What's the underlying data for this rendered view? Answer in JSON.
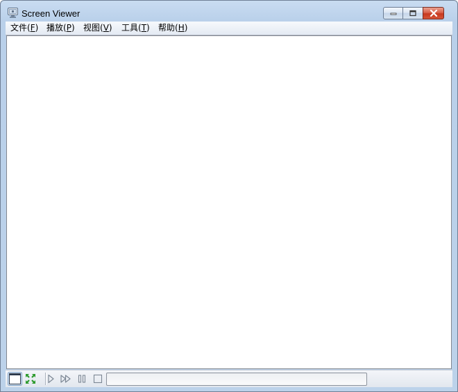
{
  "window": {
    "title": "Screen Viewer",
    "icon": "monitor-icon",
    "caption_buttons": [
      "minimize-icon",
      "maximize-icon",
      "close-icon"
    ]
  },
  "menu": [
    {
      "label": "文件(",
      "mnemonic": "F",
      "suffix": ")"
    },
    {
      "label": "播放(",
      "mnemonic": "P",
      "suffix": ")"
    },
    {
      "label": "视图(",
      "mnemonic": "V",
      "suffix": ")"
    },
    {
      "label": "工具(",
      "mnemonic": "T",
      "suffix": ")"
    },
    {
      "label": "帮助(",
      "mnemonic": "H",
      "suffix": ")"
    }
  ],
  "toolbar": {
    "buttons": [
      "window-view-icon",
      "fullscreen-icon",
      "play-icon",
      "fast-forward-icon",
      "pause-icon",
      "stop-icon"
    ],
    "progress": 0
  },
  "colors": {
    "frame": "#bcd2ea",
    "close_button": "#c7391f",
    "fullscreen_icon": "#2e9b2e"
  }
}
